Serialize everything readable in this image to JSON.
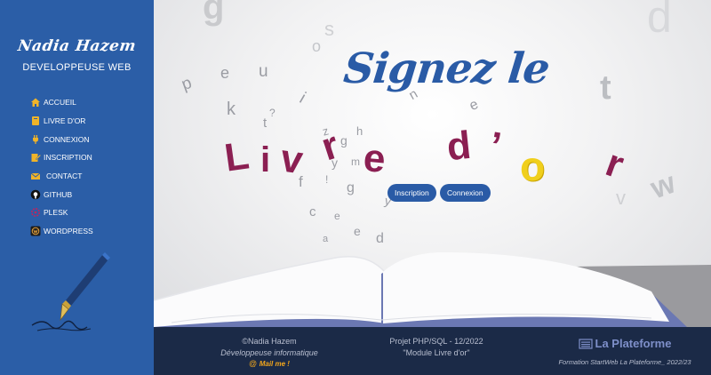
{
  "sidebar": {
    "brand_name": "Nadia Hazem",
    "brand_role": "DEVELOPPEUSE WEB",
    "nav": [
      {
        "label": "ACCUEIL",
        "icon": "home-icon"
      },
      {
        "label": "LIVRE D'OR",
        "icon": "book-icon"
      },
      {
        "label": "CONNEXION",
        "icon": "plug-icon"
      },
      {
        "label": "INSCRIPTION",
        "icon": "edit-icon"
      },
      {
        "label": "CONTACT",
        "icon": "mail-icon"
      },
      {
        "label": "GITHUB",
        "icon": "github-icon"
      },
      {
        "label": "PLESK",
        "icon": "plesk-icon"
      },
      {
        "label": "WORDPRESS",
        "icon": "wordpress-icon"
      }
    ]
  },
  "hero": {
    "title_line1": "Signez le",
    "title_line2": "Livre d'or",
    "buttons": {
      "signup": "Inscription",
      "login": "Connexion"
    }
  },
  "footer": {
    "left": {
      "copyright": "©Nadia Hazem",
      "role": "Développeuse informatique",
      "mail": "Mail me !"
    },
    "center": {
      "project": "Projet PHP/SQL - 12/2022",
      "module": "\"Module Livre d'or\""
    },
    "right": {
      "brand": "La Plateforme",
      "training": "Formation StartWeb La Plateforme_ 2022/23"
    }
  },
  "colors": {
    "sidebar": "#2b5ea7",
    "footer": "#1b2a47",
    "title_blue": "#2a5ba6",
    "title_red": "#8b1f52",
    "title_yellow": "#f0cf1c",
    "mail_orange": "#f0a51c"
  }
}
